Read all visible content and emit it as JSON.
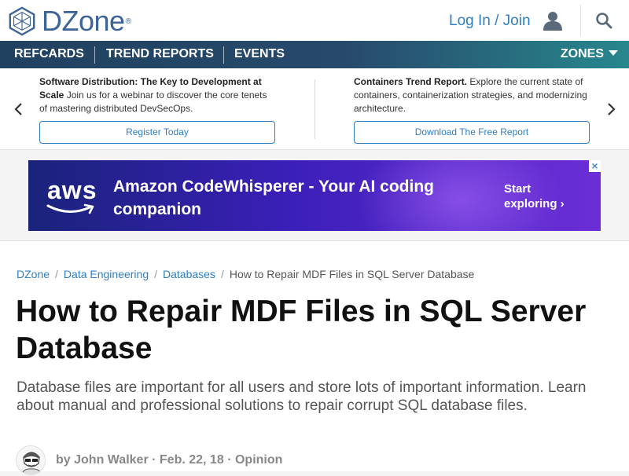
{
  "header": {
    "logo_text": "DZone",
    "logo_reg": "®",
    "login_label": "Log In / Join"
  },
  "nav": {
    "items": [
      "REFCARDS",
      "TREND REPORTS",
      "EVENTS"
    ],
    "zones_label": "ZONES"
  },
  "promos": [
    {
      "title": "Software Distribution: The Key to Development at Scale",
      "body": "Join us for a webinar to discover the core tenets of mastering distributed DevSecOps.",
      "button": "Register Today"
    },
    {
      "title": "Containers Trend Report.",
      "body": "Explore the current state of containers, containerization strategies, and modernizing architecture.",
      "button": "Download The Free Report"
    }
  ],
  "ad": {
    "brand": "aws",
    "title": "Amazon CodeWhisperer - Your AI coding companion",
    "cta": "Start exploring ›",
    "close": "×"
  },
  "breadcrumb": [
    "DZone",
    "Data Engineering",
    "Databases",
    "How to Repair MDF Files in SQL Server Database"
  ],
  "article": {
    "title": "How to Repair MDF Files in SQL Server Database",
    "subtitle": "Database files are important for all users and store lots of important information. Learn about manual and professional solutions to repair corrupt SQL database files.",
    "byline_prefix": "by",
    "author": "John Walker",
    "date": "Feb. 22, 18",
    "category": "Opinion"
  },
  "colors": {
    "brand_blue": "#3c6497",
    "link_blue": "#2f7ec4",
    "nav_start": "#20415f",
    "nav_end": "#27878d"
  }
}
